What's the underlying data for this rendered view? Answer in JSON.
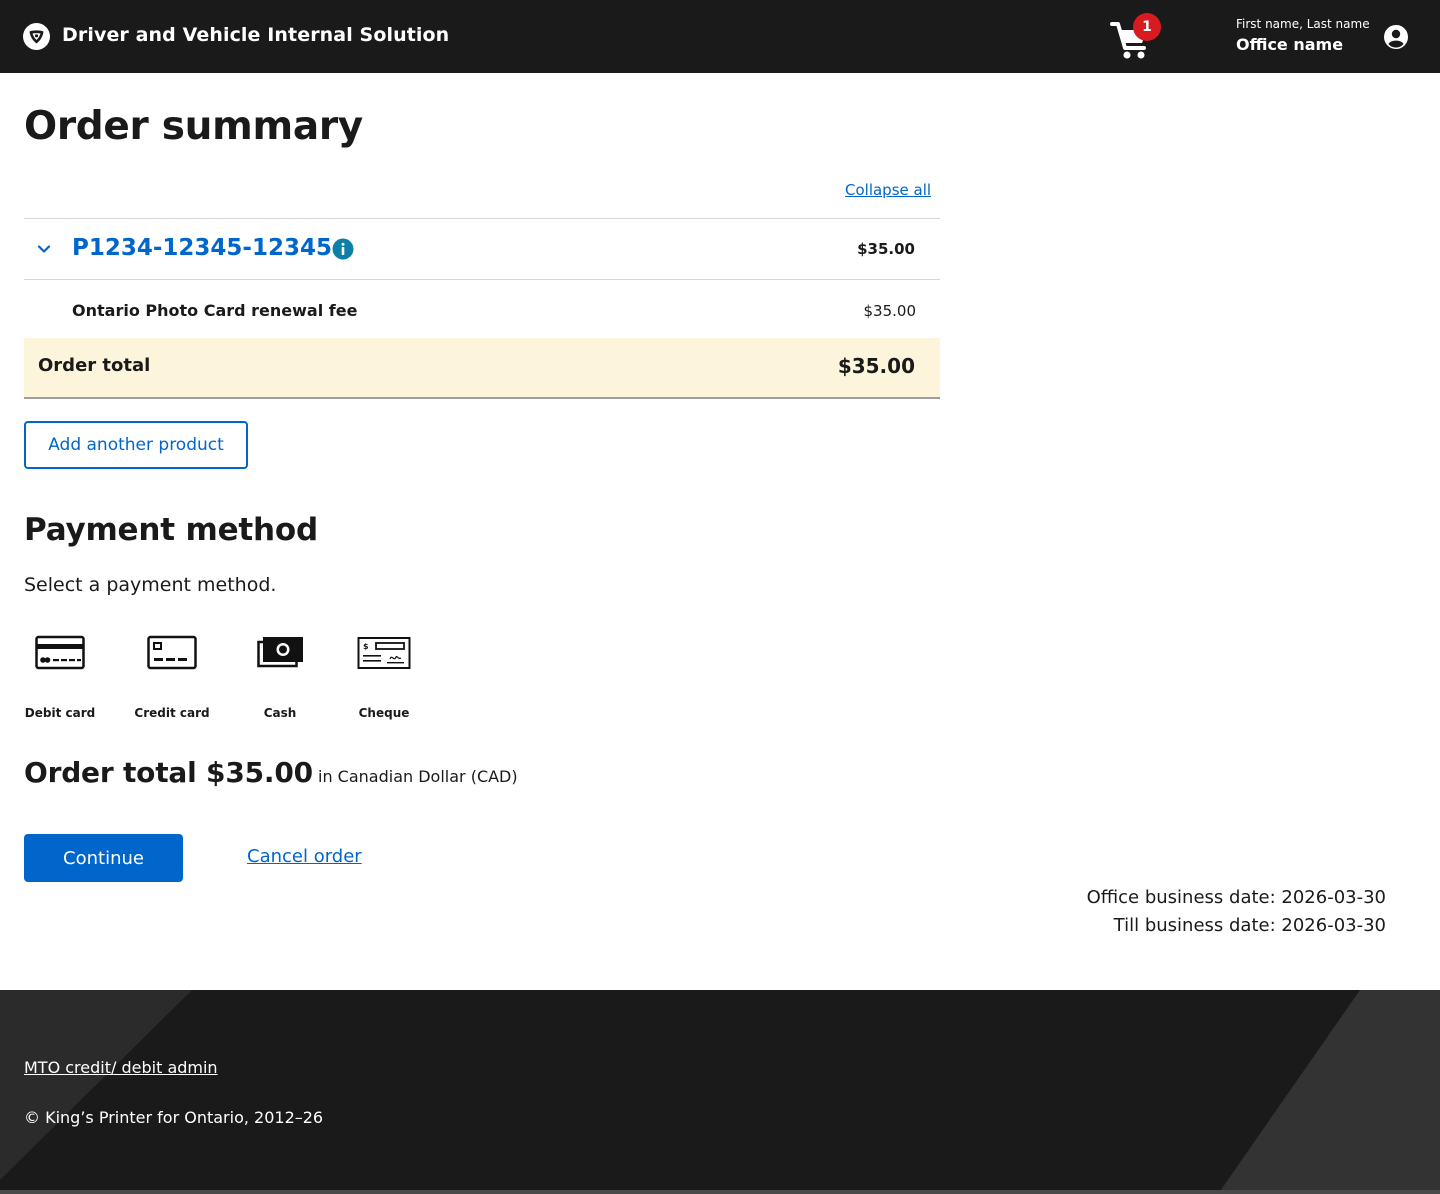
{
  "header": {
    "logo_icon": "trillium-icon",
    "app_title": "Driver and Vehicle Internal Solution",
    "cart_icon": "shopping-cart-icon",
    "cart_count": "1",
    "user_name": "First name, Last name",
    "office_name": "Office name",
    "account_icon": "account-circle-icon"
  },
  "order_summary": {
    "title": "Order summary",
    "collapse_all": "Collapse all",
    "product": {
      "id": "P1234-12345-12345",
      "amount": "$35.00",
      "expand_icon": "chevron-down-icon",
      "info_icon": "info-icon",
      "fees": [
        {
          "label": "Ontario Photo Card renewal fee",
          "amount": "$35.00"
        }
      ]
    },
    "total_label": "Order total",
    "total_amount": "$35.00",
    "add_product": "Add another product"
  },
  "payment": {
    "title": "Payment method",
    "instruction": "Select a payment method.",
    "methods": [
      {
        "label": "Debit card",
        "icon": "debit-card-icon"
      },
      {
        "label": "Credit card",
        "icon": "credit-card-icon"
      },
      {
        "label": "Cash",
        "icon": "cash-icon"
      },
      {
        "label": "Cheque",
        "icon": "cheque-icon"
      }
    ],
    "order_total_text": "Order total $35.00",
    "currency_text": "in Canadian Dollar (CAD)",
    "continue_label": "Continue",
    "cancel_label": "Cancel order"
  },
  "business_dates": {
    "office": "Office business date: 2026-03-30",
    "till": "Till business date: 2026-03-30"
  },
  "footer": {
    "admin_link": "MTO credit/ debit admin",
    "copyright": "© King’s Printer for Ontario, 2012–26"
  },
  "colors": {
    "header_bg": "#1a1a1a",
    "link_blue": "#0066cc",
    "badge_red": "#d81a21",
    "total_highlight": "#fdf4dc",
    "info_teal": "#0e7fa6"
  }
}
